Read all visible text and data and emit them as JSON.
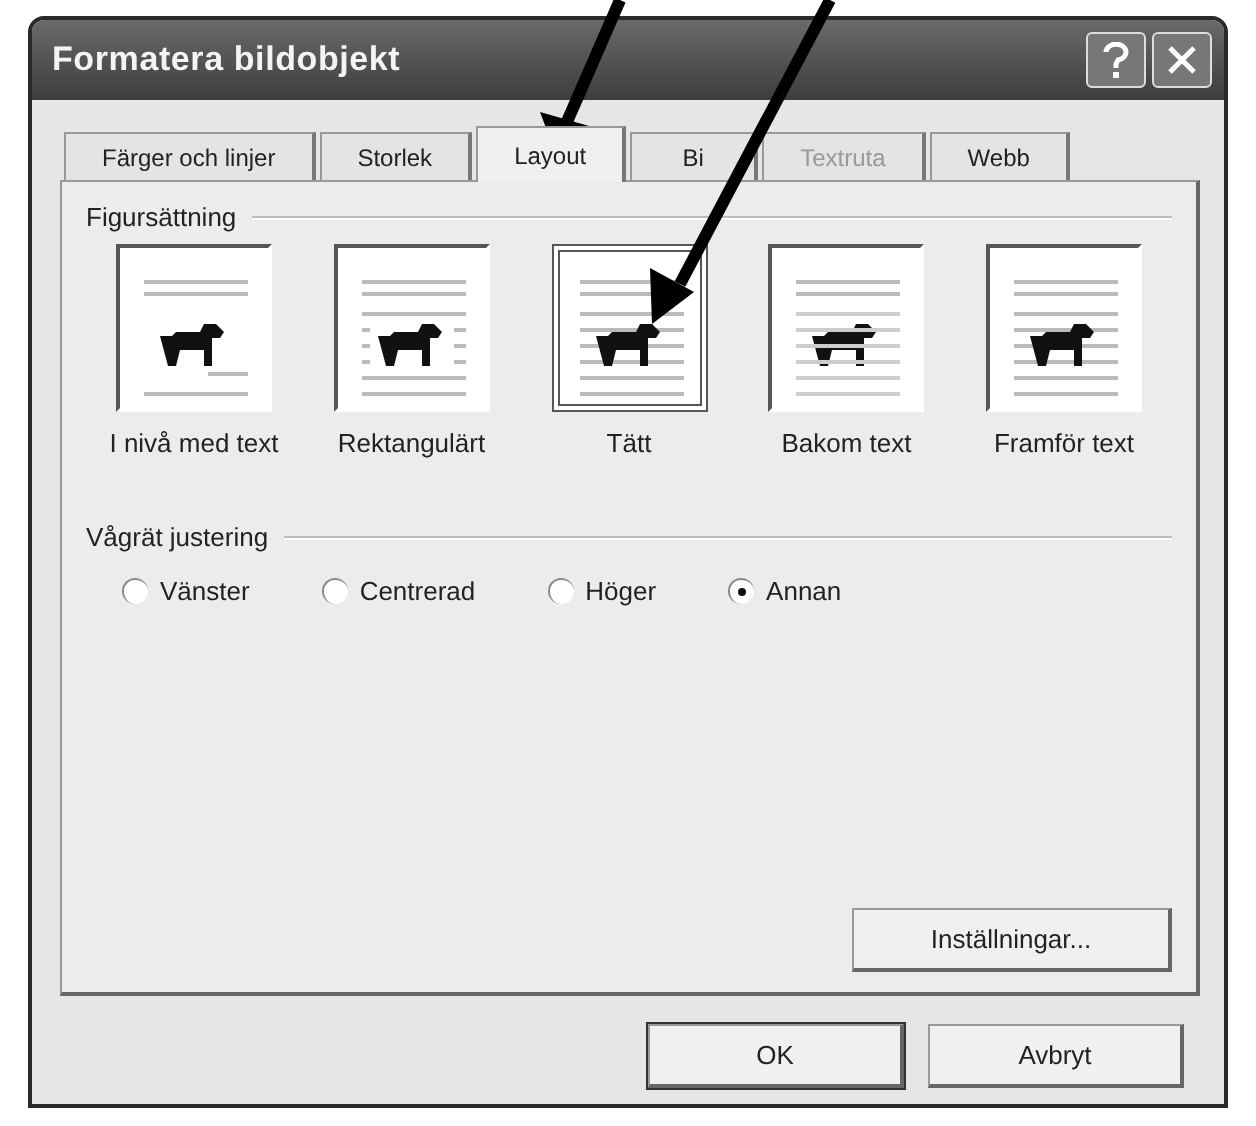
{
  "window": {
    "title": "Formatera bildobjekt"
  },
  "tabs": [
    {
      "label": "Färger och linjer",
      "selected": false,
      "disabled": false
    },
    {
      "label": "Storlek",
      "selected": false,
      "disabled": false
    },
    {
      "label": "Layout",
      "selected": true,
      "disabled": false
    },
    {
      "label": "Bi",
      "selected": false,
      "disabled": false
    },
    {
      "label": "Textruta",
      "selected": false,
      "disabled": true
    },
    {
      "label": "Webb",
      "selected": false,
      "disabled": false
    }
  ],
  "wrapping": {
    "title": "Figursättning",
    "options": [
      {
        "label": "I nivå med text",
        "kind": "inline",
        "selected": false
      },
      {
        "label": "Rektangulärt",
        "kind": "square",
        "selected": false
      },
      {
        "label": "Tätt",
        "kind": "tight",
        "selected": true
      },
      {
        "label": "Bakom text",
        "kind": "behind",
        "selected": false
      },
      {
        "label": "Framför text",
        "kind": "front",
        "selected": false
      }
    ]
  },
  "alignment": {
    "title": "Vågrät justering",
    "options": [
      {
        "label": "Vänster",
        "selected": false
      },
      {
        "label": "Centrerad",
        "selected": false
      },
      {
        "label": "Höger",
        "selected": false
      },
      {
        "label": "Annan",
        "selected": true
      }
    ]
  },
  "settings_button": "Inställningar...",
  "buttons": [
    "OK",
    "Avbryt"
  ]
}
